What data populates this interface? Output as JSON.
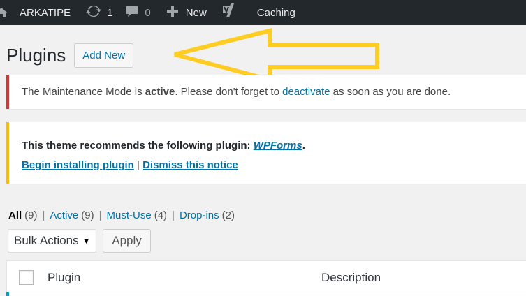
{
  "adminbar": {
    "site_name": "ARKATIPE",
    "updates_count": "1",
    "comments_count": "0",
    "new_label": "New",
    "caching_label": "Caching"
  },
  "page": {
    "title": "Plugins",
    "add_new_label": "Add New"
  },
  "notice_maintenance": {
    "text_before": "The Maintenance Mode is ",
    "bold": "active",
    "text_middle": ". Please don't forget to ",
    "link": "deactivate",
    "text_after": " as soon as you are done."
  },
  "notice_theme": {
    "text": "This theme recommends the following plugin: ",
    "plugin_link": "WPForms",
    "period": ".",
    "install_link": "Begin installing plugin",
    "separator": " | ",
    "dismiss_link": "Dismiss this notice"
  },
  "filters": [
    {
      "label": "All",
      "count": "(9)"
    },
    {
      "label": "Active",
      "count": "(9)"
    },
    {
      "label": "Must-Use",
      "count": "(4)"
    },
    {
      "label": "Drop-ins",
      "count": "(2)"
    }
  ],
  "bulk": {
    "selected": "Bulk Actions",
    "apply_label": "Apply"
  },
  "table": {
    "col_plugin": "Plugin",
    "col_description": "Description"
  },
  "colors": {
    "adminbar_bg": "#23282d",
    "link": "#0073aa",
    "error_border": "#dc3232",
    "warning_border": "#ffb900",
    "annotation_arrow": "#ffcc22"
  }
}
